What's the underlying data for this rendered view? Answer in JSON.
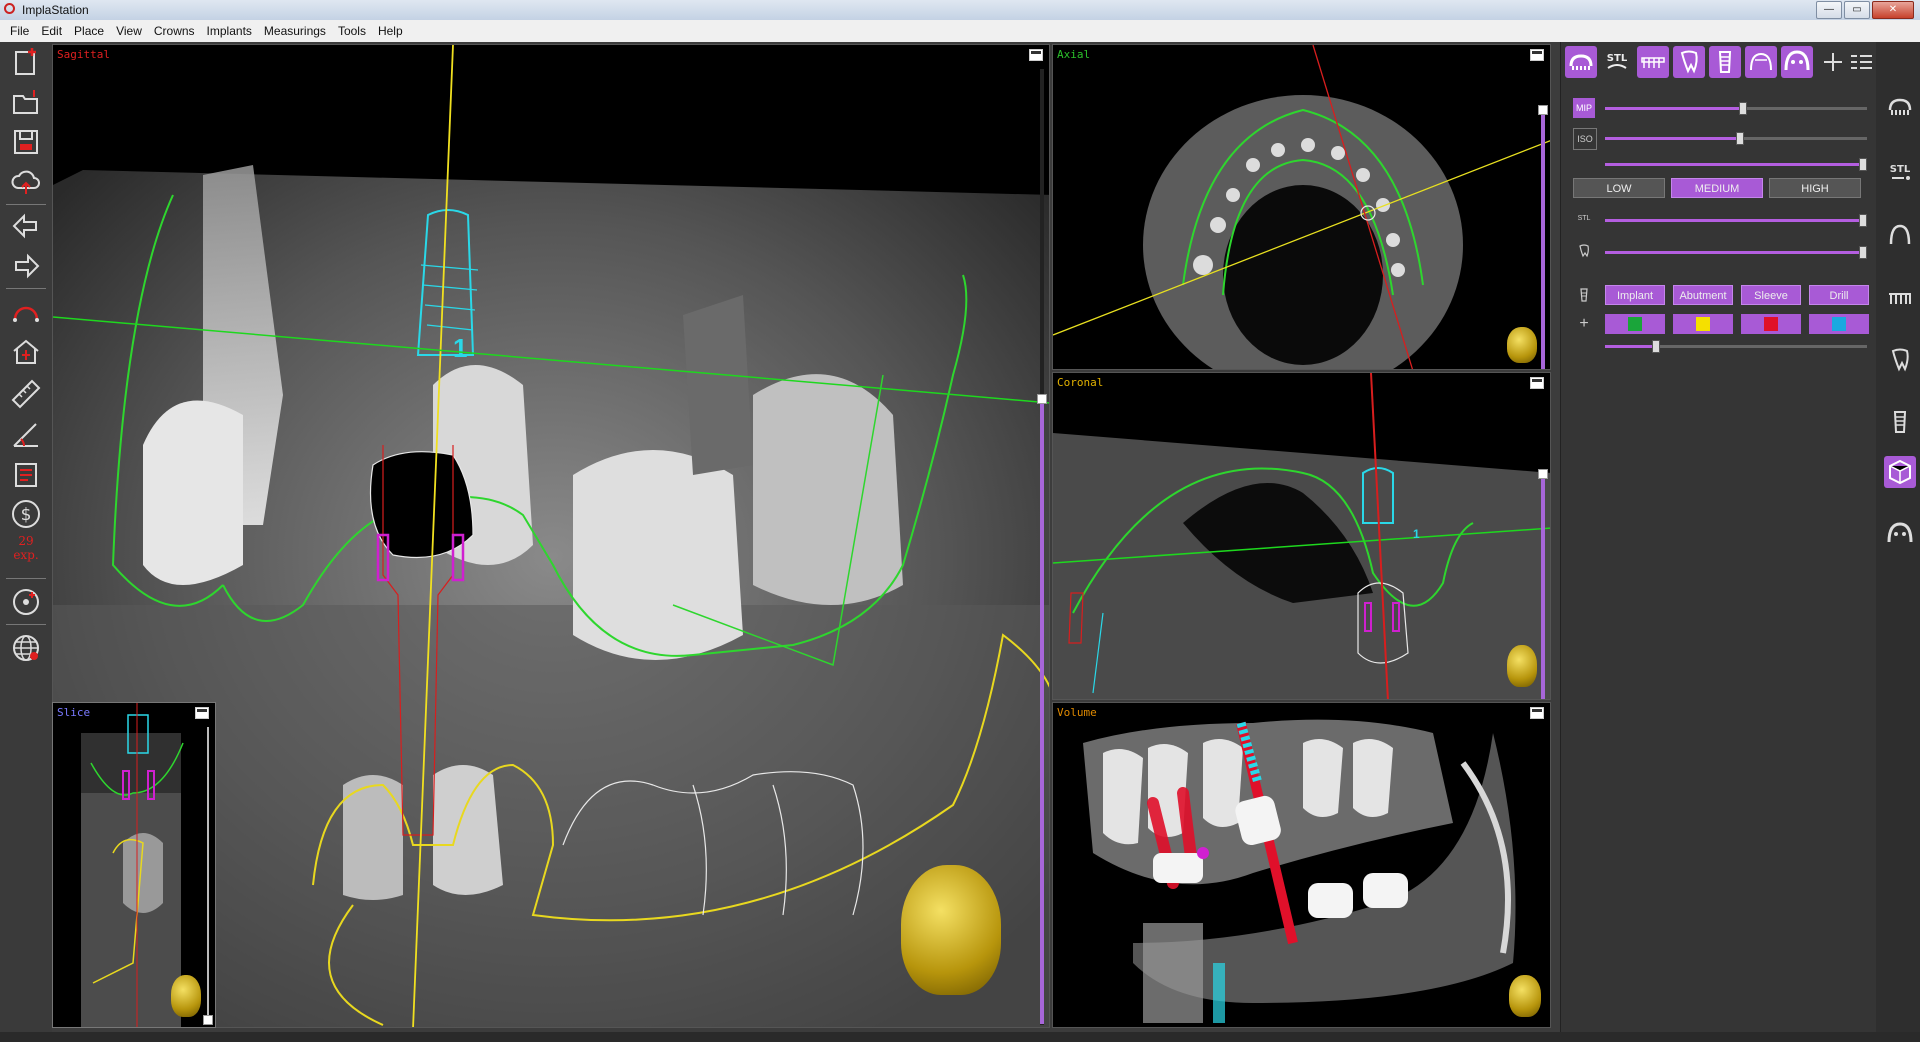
{
  "app": {
    "title": "ImplaStation",
    "window_buttons": [
      "—",
      "▭",
      "✕"
    ]
  },
  "menu": [
    "File",
    "Edit",
    "Place",
    "View",
    "Crowns",
    "Implants",
    "Measurings",
    "Tools",
    "Help"
  ],
  "left_toolbar": {
    "tools": [
      "new-project-icon",
      "open-folder-icon",
      "save-disk-icon",
      "cloud-upload-icon",
      "arrow-left-icon",
      "arrow-right-icon",
      "panoramic-curve-icon",
      "home-implant-icon",
      "ruler-icon",
      "angle-measure-icon",
      "report-icon",
      "dollar-icon",
      "disc-settings-icon",
      "globe-icon"
    ],
    "credit_count": "29",
    "credit_label": "exp."
  },
  "views": {
    "sagittal": {
      "label": "Sagittal",
      "label_color": "#e02020",
      "implant_number": "1"
    },
    "slice": {
      "label": "Slice",
      "label_color": "#7a7aff"
    },
    "axial": {
      "label": "Axial",
      "label_color": "#2bc12b"
    },
    "coronal": {
      "label": "Coronal",
      "label_color": "#e0b000",
      "implant_number": "1"
    },
    "volume": {
      "label": "Volume",
      "label_color": "#e08a00"
    }
  },
  "right_panel": {
    "top_tabs": [
      "teeth-scan-icon",
      "stl-icon",
      "dentition-icon",
      "tooth-icon",
      "implant-icon",
      "arch-icon",
      "guide-icon",
      "plus-icon",
      "list-settings-icon"
    ],
    "mip_label": "MIP",
    "iso_label": "ISO",
    "stl_label": "STL",
    "sliders": {
      "mip": 0.51,
      "iso": 0.5,
      "iso_max": 0.99,
      "stl": 0.99,
      "tooth": 0.99,
      "size": 0.19
    },
    "quality": {
      "options": [
        "LOW",
        "MEDIUM",
        "HIGH"
      ],
      "selected": "MEDIUM"
    },
    "objects": [
      "Implant",
      "Abutment",
      "Sleeve",
      "Drill"
    ],
    "colors": [
      "#1aa53a",
      "#f5e000",
      "#e0102a",
      "#1aa8e0"
    ]
  },
  "right_sidebar": {
    "icons": [
      "arch-teeth-icon",
      "stl-scan-icon",
      "nerve-canal-icon",
      "dentition-icon",
      "tooth-icon",
      "implant-icon",
      "volume-3d-icon",
      "guide-icon"
    ],
    "active": "volume-3d-icon"
  }
}
